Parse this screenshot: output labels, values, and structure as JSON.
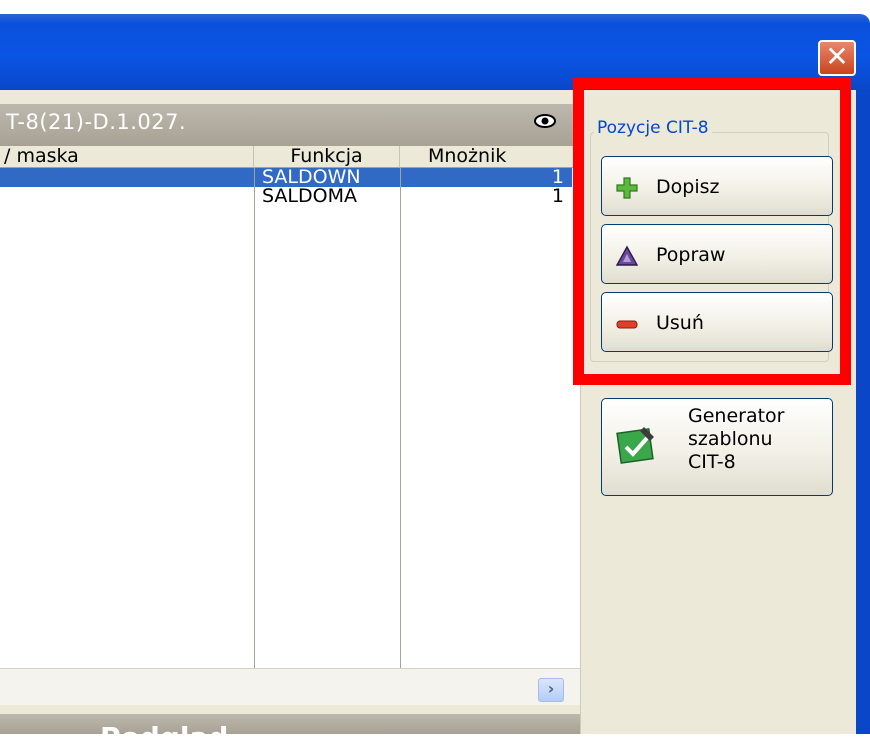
{
  "window": {
    "close_symbol": "✕"
  },
  "list": {
    "title": "T-8(21)-D.1.027.",
    "columns": [
      "/ maska",
      "Funkcja",
      "Mnożnik"
    ],
    "rows": [
      {
        "funkcja": "SALDOWN",
        "mnoznik": "1",
        "selected": true
      },
      {
        "funkcja": "SALDOMA",
        "mnoznik": "1",
        "selected": false
      }
    ],
    "scroll_symbol": "›"
  },
  "preview": {
    "title": "Podglad"
  },
  "side": {
    "group_label": "Pozycje CIT-8",
    "buttons": {
      "dopisz": {
        "label": "Dopisz",
        "icon": "plus-icon"
      },
      "popraw": {
        "label": "Popraw",
        "icon": "triangle-icon"
      },
      "usun": {
        "label": "Usuń",
        "icon": "minus-icon"
      }
    },
    "generator": {
      "line1": "Generator",
      "line2": "szablonu",
      "line3": "CIT-8",
      "icon": "generator-icon"
    }
  },
  "colors": {
    "highlight": "#ff0000",
    "selection": "#316ac5",
    "group_label": "#0046d5"
  }
}
